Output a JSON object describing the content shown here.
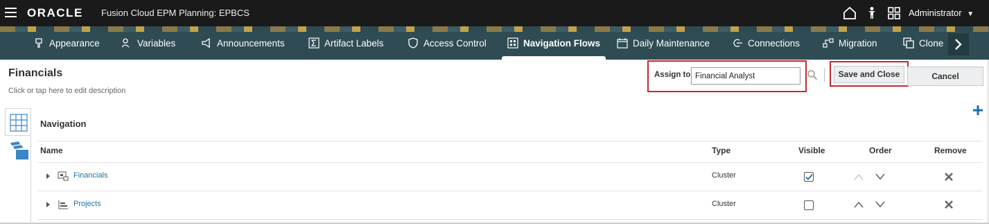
{
  "topbar": {
    "logo": "ORACLE",
    "app_title": "Fusion Cloud EPM Planning:  EPBCS",
    "user": "Administrator"
  },
  "nav": {
    "items": [
      {
        "label": "Appearance",
        "icon": "appearance-icon"
      },
      {
        "label": "Variables",
        "icon": "variables-icon"
      },
      {
        "label": "Announcements",
        "icon": "megaphone-icon"
      },
      {
        "label": "Artifact Labels",
        "icon": "sigma-icon"
      },
      {
        "label": "Access Control",
        "icon": "shield-icon"
      },
      {
        "label": "Navigation Flows",
        "icon": "navigation-flows-icon",
        "active": true
      },
      {
        "label": "Daily Maintenance",
        "icon": "calendar-icon"
      },
      {
        "label": "Connections",
        "icon": "connections-icon"
      },
      {
        "label": "Migration",
        "icon": "migration-icon"
      },
      {
        "label": "Clone",
        "icon": "clone-icon"
      }
    ]
  },
  "header": {
    "title": "Financials",
    "description": "Click or tap here to edit description",
    "assign_label": "Assign to",
    "assign_value": "Financial Analyst",
    "save_label": "Save and Close",
    "cancel_label": "Cancel"
  },
  "table": {
    "section_title": "Navigation",
    "columns": {
      "name": "Name",
      "type": "Type",
      "visible": "Visible",
      "order": "Order",
      "remove": "Remove"
    },
    "rows": [
      {
        "name": "Financials",
        "type": "Cluster",
        "visible": true
      },
      {
        "name": "Projects",
        "type": "Cluster",
        "visible": false
      }
    ]
  },
  "colors": {
    "nav_bg": "#2f4c54",
    "highlight": "#c6262e",
    "link": "#1a6ea6",
    "add": "#1a6ea6"
  }
}
